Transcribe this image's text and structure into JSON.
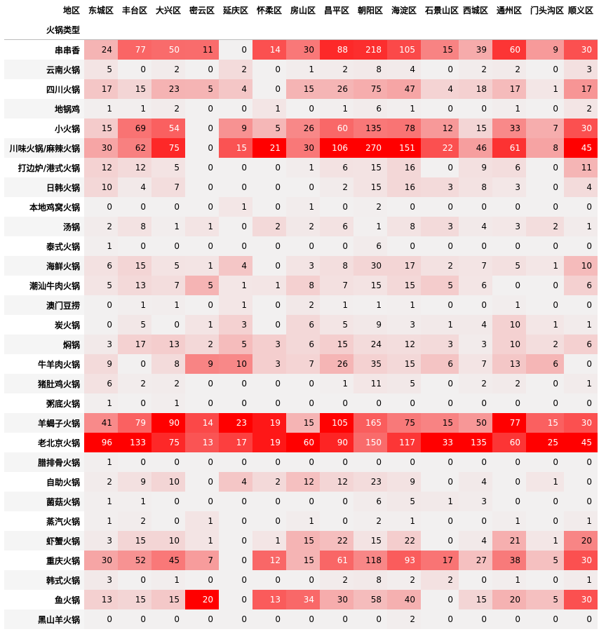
{
  "chart_data": {
    "type": "heatmap",
    "title": "",
    "column_axis_label": "地区",
    "row_axis_label": "火锅类型",
    "columns": [
      "东城区",
      "丰台区",
      "大兴区",
      "密云区",
      "延庆区",
      "怀柔区",
      "房山区",
      "昌平区",
      "朝阳区",
      "海淀区",
      "石景山区",
      "西城区",
      "通州区",
      "门头沟区",
      "顺义区"
    ],
    "rows": [
      {
        "label": "串串香",
        "values": [
          24,
          77,
          50,
          11,
          0,
          14,
          30,
          88,
          218,
          105,
          15,
          39,
          60,
          9,
          30
        ]
      },
      {
        "label": "云南火锅",
        "values": [
          5,
          0,
          2,
          0,
          2,
          0,
          1,
          2,
          8,
          4,
          0,
          2,
          2,
          0,
          3
        ]
      },
      {
        "label": "四川火锅",
        "values": [
          17,
          15,
          23,
          5,
          4,
          0,
          15,
          26,
          75,
          47,
          4,
          18,
          17,
          1,
          17
        ]
      },
      {
        "label": "地锅鸡",
        "values": [
          1,
          1,
          2,
          0,
          0,
          1,
          0,
          1,
          6,
          1,
          0,
          0,
          1,
          0,
          2
        ]
      },
      {
        "label": "小火锅",
        "values": [
          15,
          69,
          54,
          0,
          9,
          5,
          26,
          60,
          135,
          78,
          12,
          15,
          33,
          7,
          30
        ]
      },
      {
        "label": "川味火锅/麻辣火锅",
        "values": [
          30,
          62,
          75,
          0,
          15,
          21,
          30,
          106,
          270,
          151,
          22,
          46,
          61,
          8,
          45
        ]
      },
      {
        "label": "打边炉/港式火锅",
        "values": [
          12,
          12,
          5,
          0,
          0,
          0,
          1,
          6,
          15,
          16,
          0,
          9,
          6,
          0,
          11
        ]
      },
      {
        "label": "日韩火锅",
        "values": [
          10,
          4,
          7,
          0,
          0,
          0,
          0,
          2,
          15,
          16,
          3,
          8,
          3,
          0,
          4
        ]
      },
      {
        "label": "本地鸡窝火锅",
        "values": [
          0,
          0,
          0,
          0,
          1,
          0,
          1,
          0,
          2,
          0,
          0,
          0,
          0,
          0,
          0
        ]
      },
      {
        "label": "汤锅",
        "values": [
          2,
          8,
          1,
          1,
          0,
          2,
          2,
          6,
          1,
          8,
          3,
          4,
          3,
          2,
          1
        ]
      },
      {
        "label": "泰式火锅",
        "values": [
          1,
          0,
          0,
          0,
          0,
          0,
          0,
          0,
          6,
          0,
          0,
          0,
          0,
          0,
          0
        ]
      },
      {
        "label": "海鲜火锅",
        "values": [
          6,
          15,
          5,
          1,
          4,
          0,
          3,
          8,
          30,
          17,
          2,
          7,
          5,
          1,
          10
        ]
      },
      {
        "label": "潮汕牛肉火锅",
        "values": [
          5,
          13,
          7,
          5,
          1,
          1,
          8,
          7,
          15,
          15,
          5,
          6,
          0,
          0,
          6
        ]
      },
      {
        "label": "澳门豆捞",
        "values": [
          0,
          1,
          1,
          0,
          1,
          0,
          2,
          1,
          1,
          1,
          0,
          0,
          1,
          0,
          0
        ]
      },
      {
        "label": "炭火锅",
        "values": [
          0,
          5,
          0,
          1,
          3,
          0,
          6,
          5,
          9,
          3,
          1,
          4,
          10,
          1,
          1
        ]
      },
      {
        "label": "焖锅",
        "values": [
          3,
          17,
          13,
          2,
          5,
          3,
          6,
          15,
          24,
          12,
          3,
          3,
          10,
          2,
          6
        ]
      },
      {
        "label": "牛羊肉火锅",
        "values": [
          9,
          0,
          8,
          9,
          10,
          3,
          7,
          26,
          35,
          15,
          6,
          7,
          13,
          6,
          0
        ]
      },
      {
        "label": "猪肚鸡火锅",
        "values": [
          6,
          2,
          2,
          0,
          0,
          0,
          0,
          1,
          11,
          5,
          0,
          2,
          2,
          0,
          1
        ]
      },
      {
        "label": "粥底火锅",
        "values": [
          1,
          0,
          1,
          0,
          0,
          0,
          0,
          0,
          0,
          0,
          0,
          0,
          0,
          0,
          0
        ]
      },
      {
        "label": "羊蝎子火锅",
        "values": [
          41,
          79,
          90,
          14,
          23,
          19,
          15,
          105,
          165,
          75,
          15,
          50,
          77,
          15,
          30
        ]
      },
      {
        "label": "老北京火锅",
        "values": [
          96,
          133,
          75,
          13,
          17,
          19,
          60,
          90,
          150,
          117,
          33,
          135,
          60,
          25,
          45
        ]
      },
      {
        "label": "腊排骨火锅",
        "values": [
          1,
          0,
          0,
          0,
          0,
          0,
          0,
          0,
          0,
          0,
          0,
          0,
          0,
          0,
          0
        ]
      },
      {
        "label": "自助火锅",
        "values": [
          2,
          9,
          10,
          0,
          4,
          2,
          12,
          12,
          23,
          9,
          0,
          4,
          0,
          1,
          0
        ]
      },
      {
        "label": "菌菇火锅",
        "values": [
          1,
          1,
          0,
          0,
          0,
          0,
          0,
          0,
          6,
          5,
          1,
          3,
          0,
          0,
          0
        ]
      },
      {
        "label": "蒸汽火锅",
        "values": [
          1,
          2,
          0,
          1,
          0,
          0,
          1,
          0,
          2,
          1,
          0,
          0,
          1,
          0,
          1
        ]
      },
      {
        "label": "虾蟹火锅",
        "values": [
          3,
          15,
          10,
          1,
          0,
          1,
          15,
          22,
          15,
          22,
          0,
          4,
          21,
          1,
          20
        ]
      },
      {
        "label": "重庆火锅",
        "values": [
          30,
          52,
          45,
          7,
          0,
          12,
          15,
          61,
          118,
          93,
          17,
          27,
          38,
          5,
          30
        ]
      },
      {
        "label": "韩式火锅",
        "values": [
          3,
          0,
          1,
          0,
          0,
          0,
          0,
          2,
          8,
          2,
          2,
          0,
          1,
          0,
          1
        ]
      },
      {
        "label": "鱼火锅",
        "values": [
          13,
          15,
          15,
          20,
          0,
          13,
          34,
          30,
          58,
          40,
          0,
          15,
          20,
          5,
          30
        ]
      },
      {
        "label": "黑山羊火锅",
        "values": [
          0,
          0,
          0,
          0,
          0,
          0,
          0,
          0,
          0,
          2,
          0,
          0,
          0,
          0,
          0
        ]
      }
    ],
    "color_scale": {
      "low": "#f2f0f0",
      "high": "#ff0000",
      "normalization": "per-column"
    }
  }
}
